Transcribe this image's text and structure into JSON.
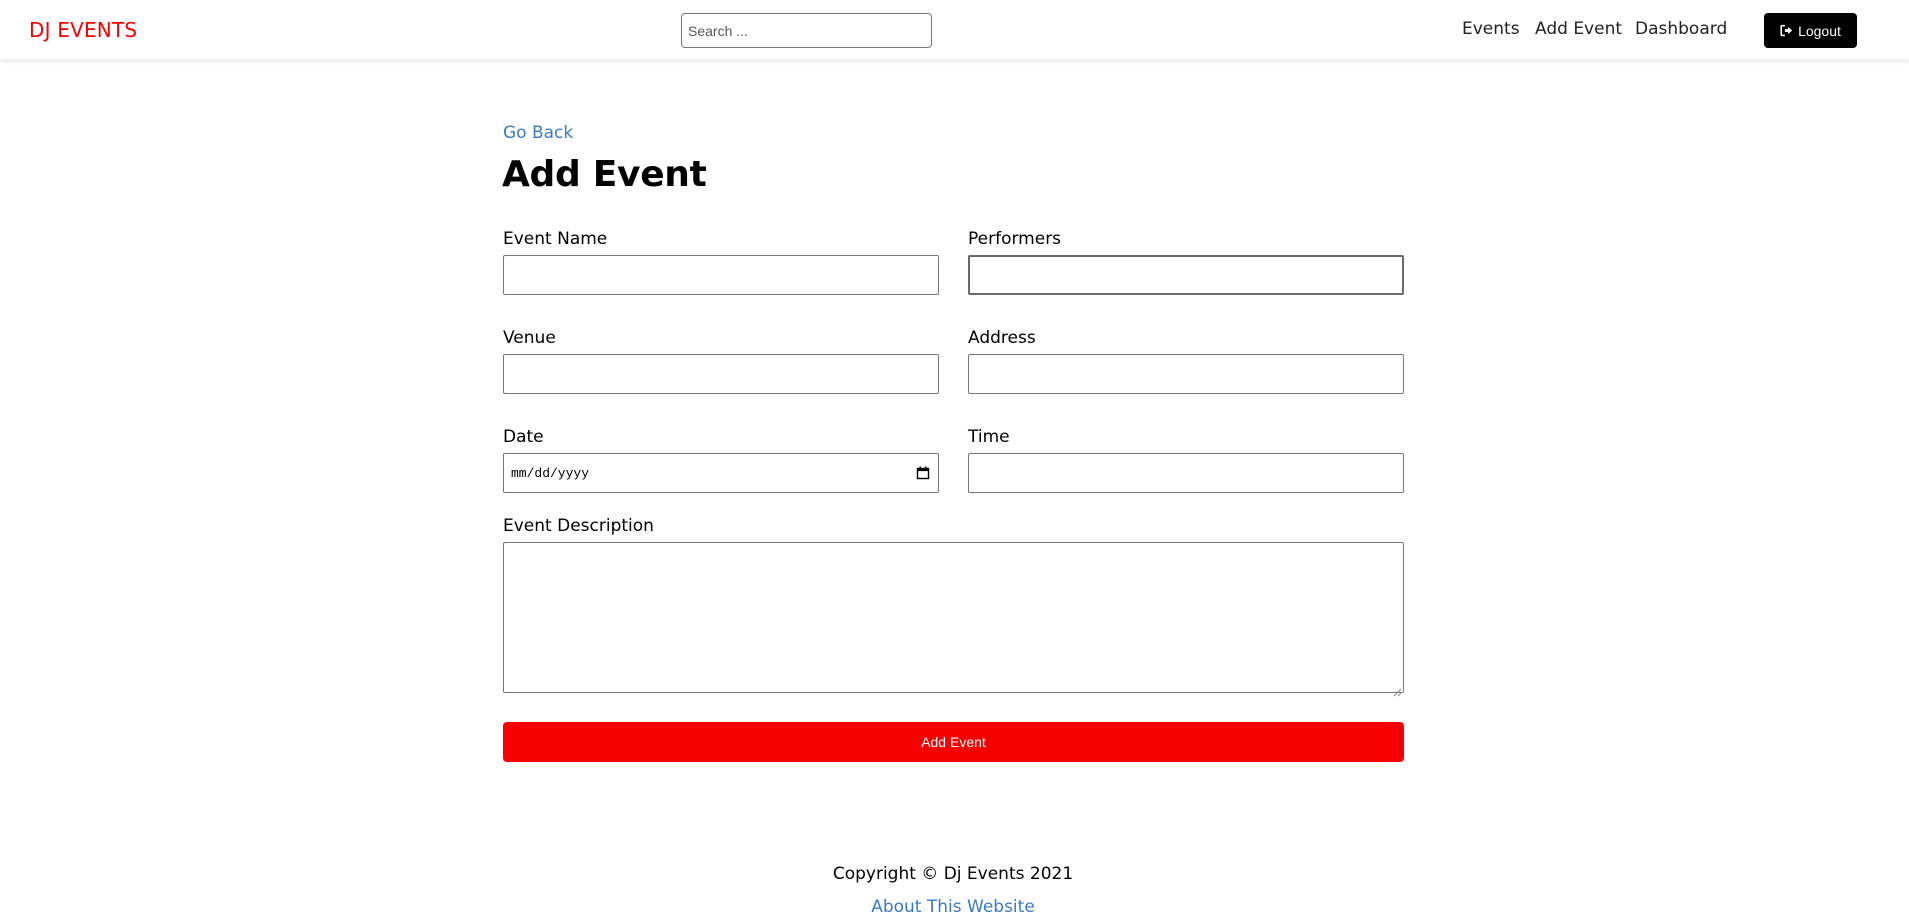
{
  "header": {
    "logo": "DJ EVENTS",
    "search_placeholder": "Search ...",
    "nav": {
      "events": "Events",
      "add_event": "Add Event",
      "dashboard": "Dashboard"
    },
    "logout_label": "Logout",
    "logout_icon": "sign-out-icon"
  },
  "main": {
    "go_back": "Go Back",
    "title": "Add Event",
    "fields": {
      "event_name": {
        "label": "Event Name",
        "value": ""
      },
      "performers": {
        "label": "Performers",
        "value": ""
      },
      "venue": {
        "label": "Venue",
        "value": ""
      },
      "address": {
        "label": "Address",
        "value": ""
      },
      "date": {
        "label": "Date",
        "placeholder": "mm/dd/yyyy",
        "icon": "calendar-icon"
      },
      "time": {
        "label": "Time",
        "value": ""
      },
      "description": {
        "label": "Event Description",
        "value": ""
      }
    },
    "submit_label": "Add Event"
  },
  "footer": {
    "copyright": "Copyright © Dj Events 2021",
    "about": "About This Website"
  },
  "colors": {
    "brand": "#f70000",
    "link": "#3a7abf",
    "logout_bg": "#000000"
  }
}
